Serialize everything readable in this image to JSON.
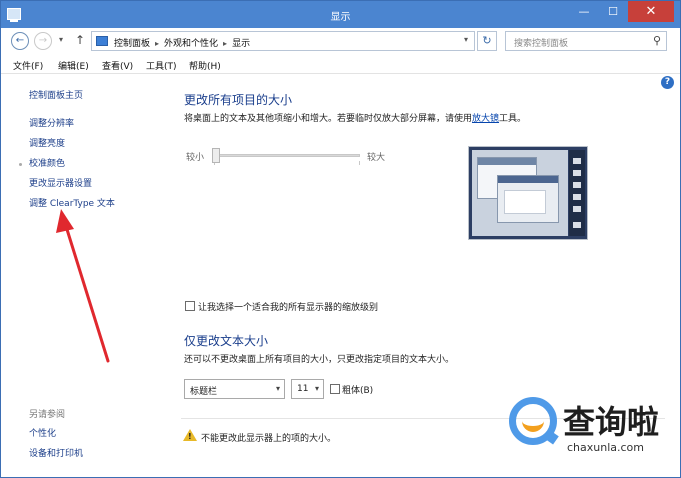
{
  "window": {
    "title": "显示"
  },
  "titlebar": {
    "minimize": "—",
    "maximize": "☐",
    "close": "✕"
  },
  "nav": {
    "back": "←",
    "forward": "→",
    "dropdown": "▾",
    "up": "↑",
    "breadcrumb": [
      "控制面板",
      "外观和个性化",
      "显示"
    ],
    "breadcrumb_sep": "▸",
    "address_dropdown": "▾",
    "refresh": "↻",
    "search_placeholder": "搜索控制面板",
    "search_icon": "⚲"
  },
  "menu": [
    "文件(F)",
    "编辑(E)",
    "查看(V)",
    "工具(T)",
    "帮助(H)"
  ],
  "help": "?",
  "left_panel": {
    "home": "控制面板主页",
    "links": [
      "调整分辨率",
      "调整亮度",
      "校准颜色",
      "更改显示器设置",
      "调整 ClearType 文本"
    ],
    "see_also_title": "另请参阅",
    "see_also": [
      "个性化",
      "设备和打印机"
    ]
  },
  "main": {
    "heading": "更改所有项目的大小",
    "description_prefix": "将桌面上的文本及其他项缩小和增大。若要临时仅放大部分屏幕，请使用",
    "magnifier_link": "放大镜",
    "description_suffix": "工具。",
    "slider": {
      "small_label": "较小",
      "large_label": "较大",
      "level": 0
    },
    "custom_scaling_checkbox": "让我选择一个适合我的所有显示器的缩放级别",
    "text_heading": "仅更改文本大小",
    "text_description": "还可以不更改桌面上所有项目的大小，只更改指定项目的文本大小。",
    "item_select": {
      "value": "标题栏",
      "arrow": "▾"
    },
    "size_select": {
      "value": "11",
      "arrow": "▾"
    },
    "bold_checkbox": "粗体(B)",
    "warning_mark": "!",
    "warning": "不能更改此显示器上的项的大小。"
  },
  "watermark": {
    "brand_cn": "查询啦",
    "brand_en": "chaxunla.com"
  },
  "colors": {
    "titlebar": "#4b85d0",
    "link": "#1d3f8a",
    "heading": "#1a3e8c",
    "arrow": "#e0282e"
  }
}
